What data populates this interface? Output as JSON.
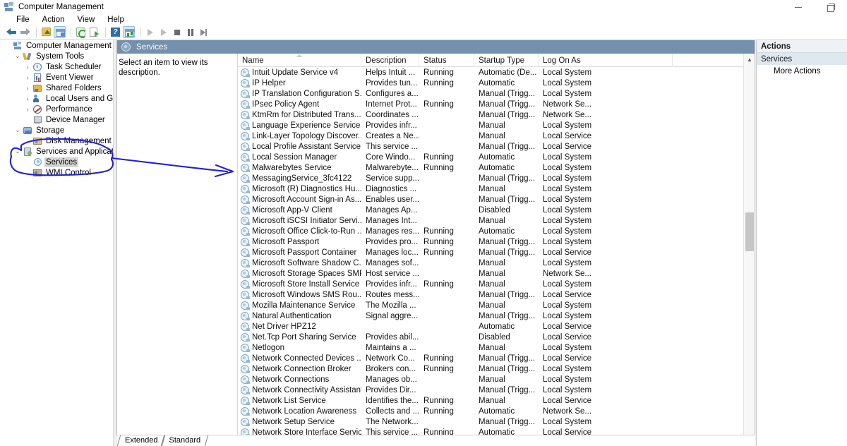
{
  "window": {
    "title": "Computer Management",
    "icon": "computer-management-icon",
    "minimize_label": "–",
    "restore_label": "❐"
  },
  "menubar": {
    "items": [
      "File",
      "Action",
      "View",
      "Help"
    ]
  },
  "toolbar": {
    "items": [
      {
        "name": "back-icon",
        "kind": "arrow-back"
      },
      {
        "name": "forward-icon",
        "kind": "arrow-forward"
      },
      {
        "name": "up-one-level-icon",
        "kind": "folder-up"
      },
      {
        "name": "show-hide-console-tree-icon",
        "kind": "window",
        "active": true
      },
      {
        "name": "refresh-icon",
        "kind": "refresh"
      },
      {
        "name": "export-list-icon",
        "kind": "export"
      },
      {
        "name": "help-icon",
        "kind": "help",
        "glyph": "?"
      },
      {
        "name": "show-hide-action-pane-icon",
        "kind": "grid",
        "active": true
      },
      {
        "name": "start-service-icon",
        "kind": "play"
      },
      {
        "name": "resume-service-icon",
        "kind": "play"
      },
      {
        "name": "stop-service-icon",
        "kind": "stop"
      },
      {
        "name": "pause-service-icon",
        "kind": "pause"
      },
      {
        "name": "restart-service-icon",
        "kind": "step"
      }
    ]
  },
  "tree": {
    "items": [
      {
        "label": "Computer Management (Local)",
        "indent": 0,
        "twisty": "",
        "icon": "ti-computer",
        "selected": false
      },
      {
        "label": "System Tools",
        "indent": 1,
        "twisty": "⌄",
        "icon": "ti-tools",
        "selected": false
      },
      {
        "label": "Task Scheduler",
        "indent": 2,
        "twisty": "›",
        "icon": "ti-clock",
        "selected": false
      },
      {
        "label": "Event Viewer",
        "indent": 2,
        "twisty": "›",
        "icon": "ti-event",
        "selected": false
      },
      {
        "label": "Shared Folders",
        "indent": 2,
        "twisty": "›",
        "icon": "ti-shared",
        "selected": false
      },
      {
        "label": "Local Users and Groups",
        "indent": 2,
        "twisty": "›",
        "icon": "ti-users",
        "selected": false
      },
      {
        "label": "Performance",
        "indent": 2,
        "twisty": "›",
        "icon": "ti-perf",
        "selected": false
      },
      {
        "label": "Device Manager",
        "indent": 2,
        "twisty": "",
        "icon": "ti-device",
        "selected": false
      },
      {
        "label": "Storage",
        "indent": 1,
        "twisty": "⌄",
        "icon": "ti-storage",
        "selected": false
      },
      {
        "label": "Disk Management",
        "indent": 2,
        "twisty": "",
        "icon": "ti-disk",
        "selected": false
      },
      {
        "label": "Services and Applications",
        "indent": 1,
        "twisty": "⌄",
        "icon": "ti-svcapp",
        "selected": false
      },
      {
        "label": "Services",
        "indent": 2,
        "twisty": "",
        "icon": "ti-gear",
        "selected": true
      },
      {
        "label": "WMI Control",
        "indent": 2,
        "twisty": "",
        "icon": "ti-wmi",
        "selected": false
      }
    ]
  },
  "center": {
    "header_title": "Services",
    "description_placeholder": "Select an item to view its description.",
    "columns": [
      "Name",
      "Description",
      "Status",
      "Startup Type",
      "Log On As"
    ],
    "sorted_column": "Name",
    "tabs": [
      "Extended",
      "Standard"
    ],
    "active_tab": "Standard",
    "rows": [
      {
        "name": "Intuit Update Service v4",
        "description": "Helps Intuit ...",
        "status": "Running",
        "startup": "Automatic (De...",
        "logon": "Local System"
      },
      {
        "name": "IP Helper",
        "description": "Provides tun...",
        "status": "Running",
        "startup": "Automatic",
        "logon": "Local System"
      },
      {
        "name": "IP Translation Configuration S...",
        "description": "Configures a...",
        "status": "",
        "startup": "Manual (Trigg...",
        "logon": "Local System"
      },
      {
        "name": "IPsec Policy Agent",
        "description": "Internet Prot...",
        "status": "Running",
        "startup": "Manual (Trigg...",
        "logon": "Network Se..."
      },
      {
        "name": "KtmRm for Distributed Trans...",
        "description": "Coordinates ...",
        "status": "",
        "startup": "Manual (Trigg...",
        "logon": "Network Se..."
      },
      {
        "name": "Language Experience Service",
        "description": "Provides infr...",
        "status": "",
        "startup": "Manual",
        "logon": "Local System"
      },
      {
        "name": "Link-Layer Topology Discover...",
        "description": "Creates a Ne...",
        "status": "",
        "startup": "Manual",
        "logon": "Local Service"
      },
      {
        "name": "Local Profile Assistant Service",
        "description": "This service ...",
        "status": "",
        "startup": "Manual (Trigg...",
        "logon": "Local Service"
      },
      {
        "name": "Local Session Manager",
        "description": "Core Windo...",
        "status": "Running",
        "startup": "Automatic",
        "logon": "Local System"
      },
      {
        "name": "Malwarebytes Service",
        "description": "Malwarebyte...",
        "status": "Running",
        "startup": "Automatic",
        "logon": "Local System"
      },
      {
        "name": "MessagingService_3fc4122",
        "description": "Service supp...",
        "status": "",
        "startup": "Manual (Trigg...",
        "logon": "Local System"
      },
      {
        "name": "Microsoft (R) Diagnostics Hu...",
        "description": "Diagnostics ...",
        "status": "",
        "startup": "Manual",
        "logon": "Local System"
      },
      {
        "name": "Microsoft Account Sign-in As...",
        "description": "Enables user...",
        "status": "",
        "startup": "Manual (Trigg...",
        "logon": "Local System"
      },
      {
        "name": "Microsoft App-V Client",
        "description": "Manages Ap...",
        "status": "",
        "startup": "Disabled",
        "logon": "Local System"
      },
      {
        "name": "Microsoft iSCSI Initiator Servi...",
        "description": "Manages Int...",
        "status": "",
        "startup": "Manual",
        "logon": "Local System"
      },
      {
        "name": "Microsoft Office Click-to-Run ...",
        "description": "Manages res...",
        "status": "Running",
        "startup": "Automatic",
        "logon": "Local System"
      },
      {
        "name": "Microsoft Passport",
        "description": "Provides pro...",
        "status": "Running",
        "startup": "Manual (Trigg...",
        "logon": "Local System"
      },
      {
        "name": "Microsoft Passport Container",
        "description": "Manages loc...",
        "status": "Running",
        "startup": "Manual (Trigg...",
        "logon": "Local Service"
      },
      {
        "name": "Microsoft Software Shadow C...",
        "description": "Manages sof...",
        "status": "",
        "startup": "Manual",
        "logon": "Local System"
      },
      {
        "name": "Microsoft Storage Spaces SMP",
        "description": "Host service ...",
        "status": "",
        "startup": "Manual",
        "logon": "Network Se..."
      },
      {
        "name": "Microsoft Store Install Service",
        "description": "Provides infr...",
        "status": "Running",
        "startup": "Manual",
        "logon": "Local System"
      },
      {
        "name": "Microsoft Windows SMS Rou...",
        "description": "Routes mess...",
        "status": "",
        "startup": "Manual (Trigg...",
        "logon": "Local Service"
      },
      {
        "name": "Mozilla Maintenance Service",
        "description": "The Mozilla ...",
        "status": "",
        "startup": "Manual",
        "logon": "Local System"
      },
      {
        "name": "Natural Authentication",
        "description": "Signal aggre...",
        "status": "",
        "startup": "Manual (Trigg...",
        "logon": "Local System"
      },
      {
        "name": "Net Driver HPZ12",
        "description": "",
        "status": "",
        "startup": "Automatic",
        "logon": "Local Service"
      },
      {
        "name": "Net.Tcp Port Sharing Service",
        "description": "Provides abil...",
        "status": "",
        "startup": "Disabled",
        "logon": "Local Service"
      },
      {
        "name": "Netlogon",
        "description": "Maintains a ...",
        "status": "",
        "startup": "Manual",
        "logon": "Local System"
      },
      {
        "name": "Network Connected Devices ...",
        "description": "Network Co...",
        "status": "Running",
        "startup": "Manual (Trigg...",
        "logon": "Local Service"
      },
      {
        "name": "Network Connection Broker",
        "description": "Brokers con...",
        "status": "Running",
        "startup": "Manual (Trigg...",
        "logon": "Local System"
      },
      {
        "name": "Network Connections",
        "description": "Manages ob...",
        "status": "",
        "startup": "Manual",
        "logon": "Local System"
      },
      {
        "name": "Network Connectivity Assistant",
        "description": "Provides Dir...",
        "status": "",
        "startup": "Manual (Trigg...",
        "logon": "Local System"
      },
      {
        "name": "Network List Service",
        "description": "Identifies the...",
        "status": "Running",
        "startup": "Manual",
        "logon": "Local Service"
      },
      {
        "name": "Network Location Awareness",
        "description": "Collects and ...",
        "status": "Running",
        "startup": "Automatic",
        "logon": "Network Se..."
      },
      {
        "name": "Network Setup Service",
        "description": "The Network...",
        "status": "",
        "startup": "Manual (Trigg...",
        "logon": "Local System"
      },
      {
        "name": "Network Store Interface Service",
        "description": "This service ...",
        "status": "Running",
        "startup": "Automatic",
        "logon": "Local Service"
      }
    ]
  },
  "actions": {
    "header": "Actions",
    "group": "Services",
    "items": [
      "More Actions"
    ]
  },
  "annotation": {
    "color": "#2222cc",
    "shapes": [
      "ellipse-around-services-tree-node",
      "arrow-to-malwarebytes-service"
    ]
  },
  "scrollbar": {
    "up_glyph": "▲",
    "down_glyph": "▼"
  }
}
